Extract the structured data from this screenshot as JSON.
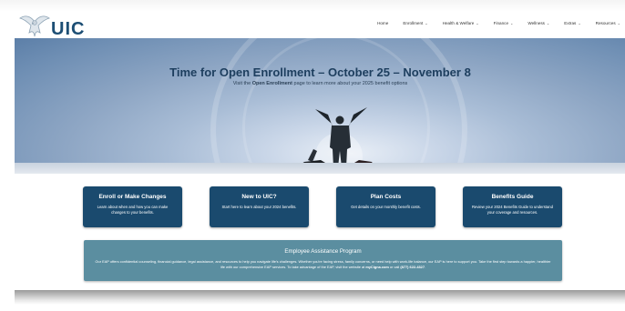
{
  "header": {
    "logo_text": "UIC",
    "nav": [
      {
        "label": "Home",
        "has_menu": false
      },
      {
        "label": "Enrollment",
        "has_menu": true
      },
      {
        "label": "Health & Welfare",
        "has_menu": true
      },
      {
        "label": "Finance",
        "has_menu": true
      },
      {
        "label": "Wellness",
        "has_menu": true
      },
      {
        "label": "Extras",
        "has_menu": true
      },
      {
        "label": "Resources",
        "has_menu": true
      }
    ]
  },
  "hero": {
    "title": "Time for Open Enrollment – October 25 – November 8",
    "subtitle_prefix": "Visit the ",
    "subtitle_link": "Open Enrollment",
    "subtitle_suffix": " page to learn more about your 2025 benefit options"
  },
  "cards": [
    {
      "title": "Enroll or Make Changes",
      "desc": "Learn about when and how you can make changes to your benefits."
    },
    {
      "title": "New to UIC?",
      "desc": "Start here to learn about your 2024 benefits."
    },
    {
      "title": "Plan Costs",
      "desc": "Get details on your monthly benefit costs."
    },
    {
      "title": "Benefits Guide",
      "desc": "Review your 2024 Benefits Guide to understand your coverage and resources."
    }
  ],
  "eap": {
    "title": "Employee Assistance Program",
    "desc_prefix": "Our EAP offers confidential counseling, financial guidance, legal assistance, and resources to help you navigate life's challenges. Whether you're facing stress, family concerns, or need help with work-life balance, our EAP is here to support you. Take the first step towards a happier, healthier life with our comprehensive EAP services. To take advantage of the EAP, visit the website at ",
    "website": "myCigna.com",
    "desc_middle": " or call ",
    "phone": "(877) 622-4327",
    "desc_suffix": "."
  },
  "colors": {
    "brand_navy": "#1a4a6e",
    "eap_teal": "#5b8ea0",
    "hero_title": "#1d3e5e"
  },
  "icons": {
    "logo": "eagle-logo-icon",
    "menu_chevron": "chevron-down-icon"
  }
}
